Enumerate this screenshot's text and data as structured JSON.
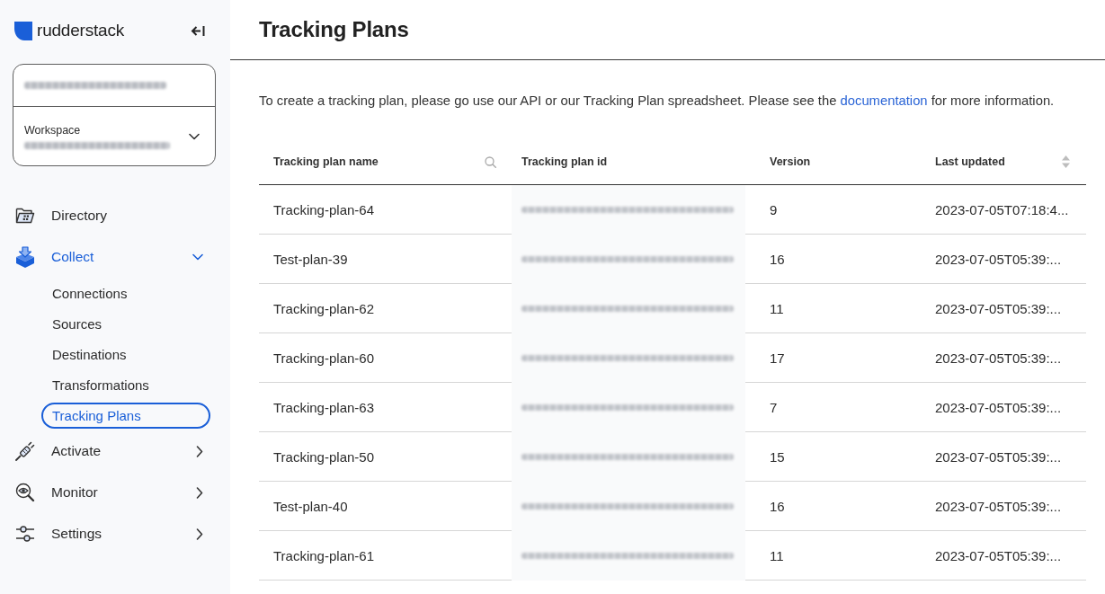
{
  "sidebar": {
    "brand": "rudderstack",
    "workspace_switcher": {
      "label": "Workspace"
    },
    "nav": [
      {
        "label": "Directory",
        "kind": "link",
        "selected": false
      },
      {
        "label": "Collect",
        "kind": "group",
        "selected": true,
        "expanded": true,
        "children": [
          {
            "label": "Connections",
            "selected": false
          },
          {
            "label": "Sources",
            "selected": false
          },
          {
            "label": "Destinations",
            "selected": false
          },
          {
            "label": "Transformations",
            "selected": false
          },
          {
            "label": "Tracking Plans",
            "selected": true
          }
        ]
      },
      {
        "label": "Activate",
        "kind": "group",
        "selected": false,
        "expanded": false
      },
      {
        "label": "Monitor",
        "kind": "group",
        "selected": false,
        "expanded": false
      },
      {
        "label": "Settings",
        "kind": "group",
        "selected": false,
        "expanded": false
      }
    ]
  },
  "page": {
    "title": "Tracking Plans",
    "intro": {
      "before": "To create a tracking plan, please go use our API or our Tracking Plan spreadsheet. Please see the ",
      "link": "documentation",
      "after": " for more information."
    },
    "table": {
      "columns": [
        {
          "label": "Tracking plan name",
          "searchable": true,
          "sortable": false
        },
        {
          "label": "Tracking plan id",
          "searchable": false,
          "sortable": false
        },
        {
          "label": "Version",
          "searchable": false,
          "sortable": false
        },
        {
          "label": "Last updated",
          "searchable": false,
          "sortable": true
        }
      ],
      "rows": [
        {
          "name": "Tracking-plan-64",
          "version": "9",
          "last_updated": "2023-07-05T07:18:4..."
        },
        {
          "name": "Test-plan-39",
          "version": "16",
          "last_updated": "2023-07-05T05:39:..."
        },
        {
          "name": "Tracking-plan-62",
          "version": "11",
          "last_updated": "2023-07-05T05:39:..."
        },
        {
          "name": "Tracking-plan-60",
          "version": "17",
          "last_updated": "2023-07-05T05:39:..."
        },
        {
          "name": "Tracking-plan-63",
          "version": "7",
          "last_updated": "2023-07-05T05:39:..."
        },
        {
          "name": "Tracking-plan-50",
          "version": "15",
          "last_updated": "2023-07-05T05:39:..."
        },
        {
          "name": "Test-plan-40",
          "version": "16",
          "last_updated": "2023-07-05T05:39:..."
        },
        {
          "name": "Tracking-plan-61",
          "version": "11",
          "last_updated": "2023-07-05T05:39:..."
        }
      ]
    }
  }
}
